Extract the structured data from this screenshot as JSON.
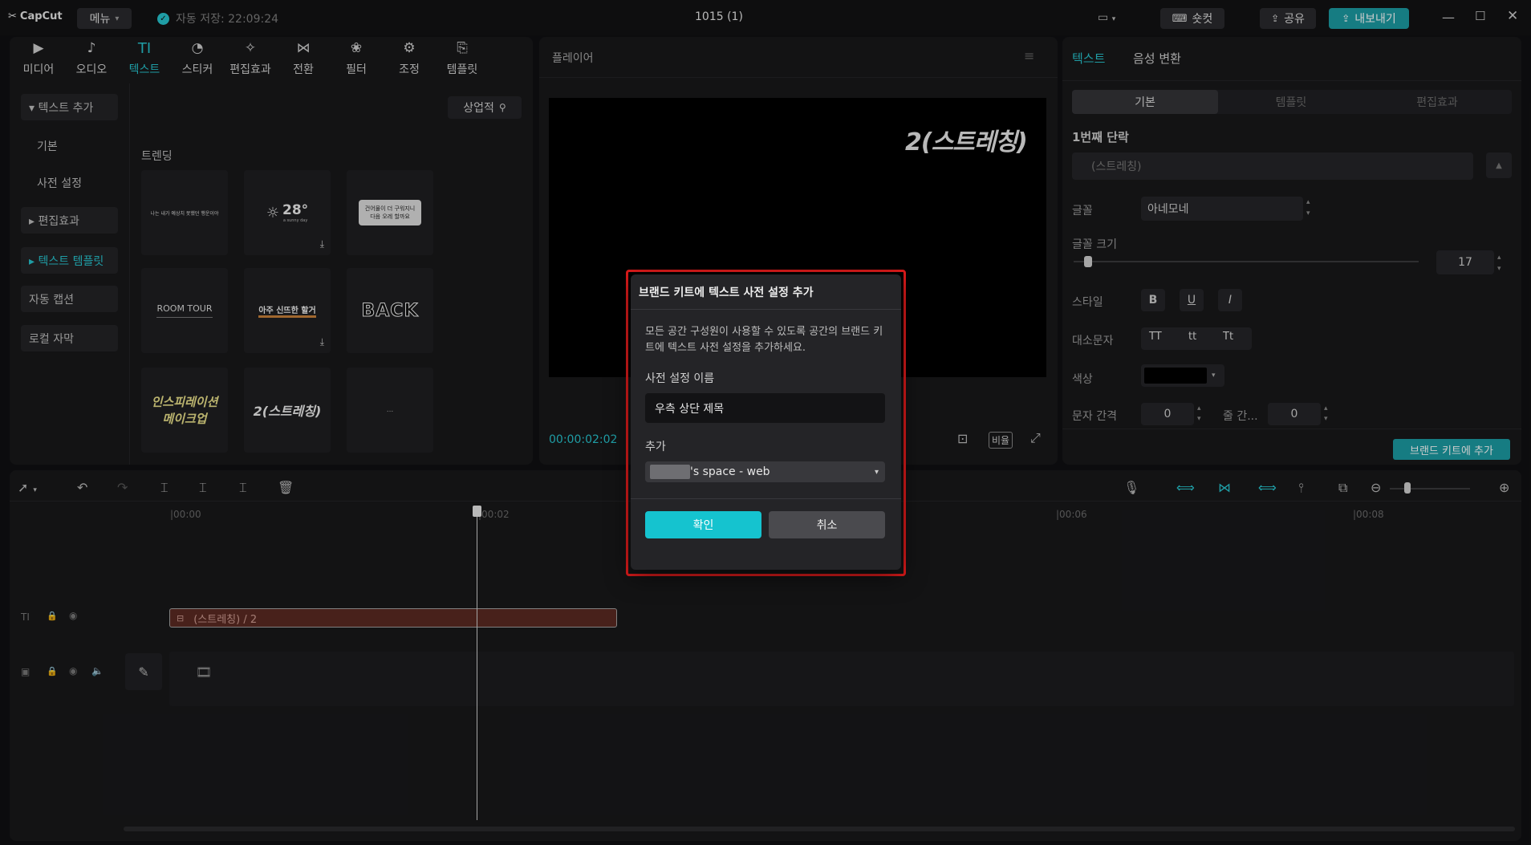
{
  "app": {
    "logo": "CapCut",
    "menu_label": "메뉴",
    "autosave": "자동 저장: 22:09:24",
    "project_title": "1015 (1)"
  },
  "topbar": {
    "shortcut_label": "숏컷",
    "share_label": "공유",
    "export_label": "내보내기"
  },
  "tools": [
    {
      "label": "미디어",
      "icon": "media-icon"
    },
    {
      "label": "오디오",
      "icon": "audio-icon"
    },
    {
      "label": "텍스트",
      "icon": "text-icon",
      "glyph": "TI"
    },
    {
      "label": "스티커",
      "icon": "sticker-icon"
    },
    {
      "label": "편집효과",
      "icon": "effects-icon"
    },
    {
      "label": "전환",
      "icon": "transition-icon"
    },
    {
      "label": "필터",
      "icon": "filter-icon"
    },
    {
      "label": "조정",
      "icon": "adjust-icon"
    },
    {
      "label": "템플릿",
      "icon": "template-icon"
    }
  ],
  "sidebar": {
    "items": [
      {
        "label": "▾ 텍스트 추가"
      },
      {
        "label": "기본"
      },
      {
        "label": "사전 설정"
      },
      {
        "label": "▸ 편집효과"
      },
      {
        "label": "▸ 텍스트 템플릿"
      },
      {
        "label": "자동 캡션"
      },
      {
        "label": "로컬 자막"
      }
    ]
  },
  "library": {
    "filter_label": "상업적",
    "section_title": "트렌딩",
    "thumbs": [
      "나는 내가 예상치 못했던 행운이야",
      "28°",
      "건어물이 더 구워지니 다음 오레 할까요",
      "ROOM TOUR",
      "아주 신뜨한 할거",
      "BACK",
      "인스피레이션 메이크업",
      "2(스트레칭)",
      "..."
    ],
    "thumb_28_sub": "a sunny day"
  },
  "player": {
    "title": "플레이어",
    "overlay_text": "2(스트레칭)",
    "timecode": "00:00:02:02",
    "ratio_label": "비율"
  },
  "props": {
    "tabs": [
      "텍스트",
      "음성 변환"
    ],
    "subtabs": [
      "기본",
      "템플릿",
      "편집효과"
    ],
    "section_title": "1번째 단락",
    "text_value": "(스트레칭)",
    "font_label": "글꼴",
    "font_value": "아네모네",
    "size_label": "글꼴 크기",
    "size_value": "17",
    "size_fraction": 0.03,
    "style_label": "스타일",
    "style_b": "B",
    "style_u": "U",
    "style_i": "I",
    "case_label": "대소문자",
    "case_options": [
      "TT",
      "tt",
      "Tt"
    ],
    "color_label": "색상",
    "spacing_label": "문자 간격",
    "spacing_value": "0",
    "line_label": "줄 간...",
    "line_value": "0",
    "brand_button": "브랜드 키트에 추가"
  },
  "timeline": {
    "ruler": [
      "|00:00",
      "|00:02",
      "|00:06",
      "|00:08"
    ],
    "text_clip": "(스트레칭)  / 2"
  },
  "modal": {
    "title": "브랜드 키트에 텍스트 사전 설정 추가",
    "description": "모든 공간 구성원이 사용할 수 있도록 공간의 브랜드 키트에 텍스트 사전 설정을 추가하세요.",
    "name_label": "사전 설정 이름",
    "name_value": "우측 상단 제목",
    "add_label": "추가",
    "space_value": "'s space - web",
    "confirm": "확인",
    "cancel": "취소"
  },
  "colors": {
    "accent": "#27c5cf",
    "highlight": "#e01b1b",
    "clip": "#5a2a22"
  }
}
